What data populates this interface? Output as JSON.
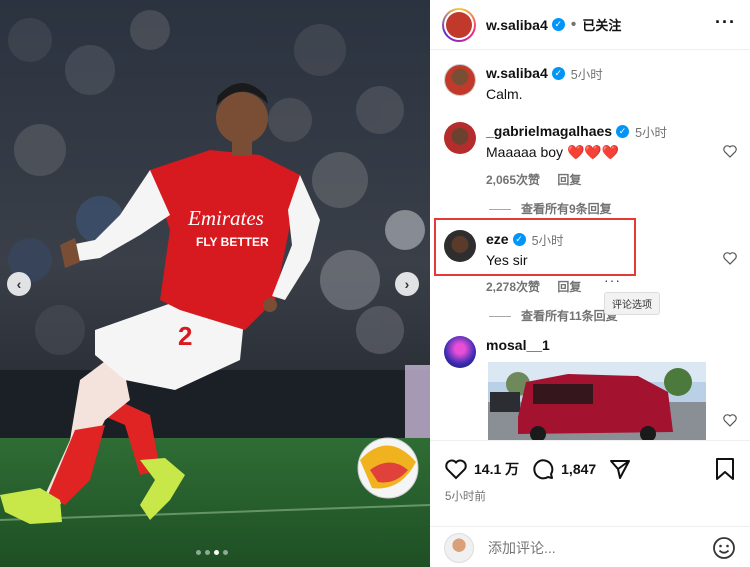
{
  "photo": {
    "shirt_sponsor_line1": "Emirates",
    "shirt_sponsor_line2": "FLY BETTER",
    "shirt_number": "2",
    "carousel_dots": 4,
    "active_dot": 2
  },
  "post": {
    "author": "w.saliba4",
    "follow_status": "已关注",
    "more_icon": "more-horizontal-icon",
    "caption": {
      "author": "w.saliba4",
      "time": "5小时",
      "text": "Calm."
    },
    "comments": [
      {
        "user": "_gabrielmagalhaes",
        "time": "5小时",
        "text": "Maaaaa boy ❤️❤️❤️",
        "likes": "2,065次赞",
        "reply_label": "回复",
        "view_replies": "查看所有9条回复"
      },
      {
        "user": "eze",
        "time": "5小时",
        "text": "Yes sir",
        "likes": "2,278次赞",
        "reply_label": "回复",
        "view_replies": "查看所有11条回复",
        "tooltip": "评论选项"
      },
      {
        "user": "mosal__1",
        "time": "",
        "text": ""
      }
    ],
    "like_count": "14.1 万",
    "comment_count": "1,847",
    "posted_ago": "5小时前",
    "add_comment_placeholder": "添加评论..."
  },
  "colors": {
    "verified": "#0095f6",
    "highlight": "#e53935",
    "arsenal_red": "#d71920"
  }
}
